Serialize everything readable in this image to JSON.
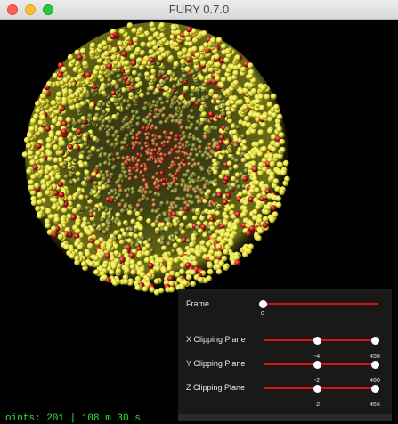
{
  "window": {
    "title": "FURY 0.7.0"
  },
  "status": {
    "text": "oints: 201 | 108 m 30 s"
  },
  "colors": {
    "track": "#e01010",
    "handle": "#ffffff",
    "panel": "#1a1a1a",
    "status": "#38e23b"
  },
  "panel": {
    "frame": {
      "label": "Frame",
      "value": "0"
    },
    "x_clip": {
      "label": "X Clipping Plane",
      "min_value": "-4",
      "max_value": "458"
    },
    "y_clip": {
      "label": "Y Clipping Plane",
      "min_value": "-2",
      "max_value": "460"
    },
    "z_clip": {
      "label": "Z Clipping Plane",
      "min_value": "-2",
      "max_value": "456"
    }
  }
}
